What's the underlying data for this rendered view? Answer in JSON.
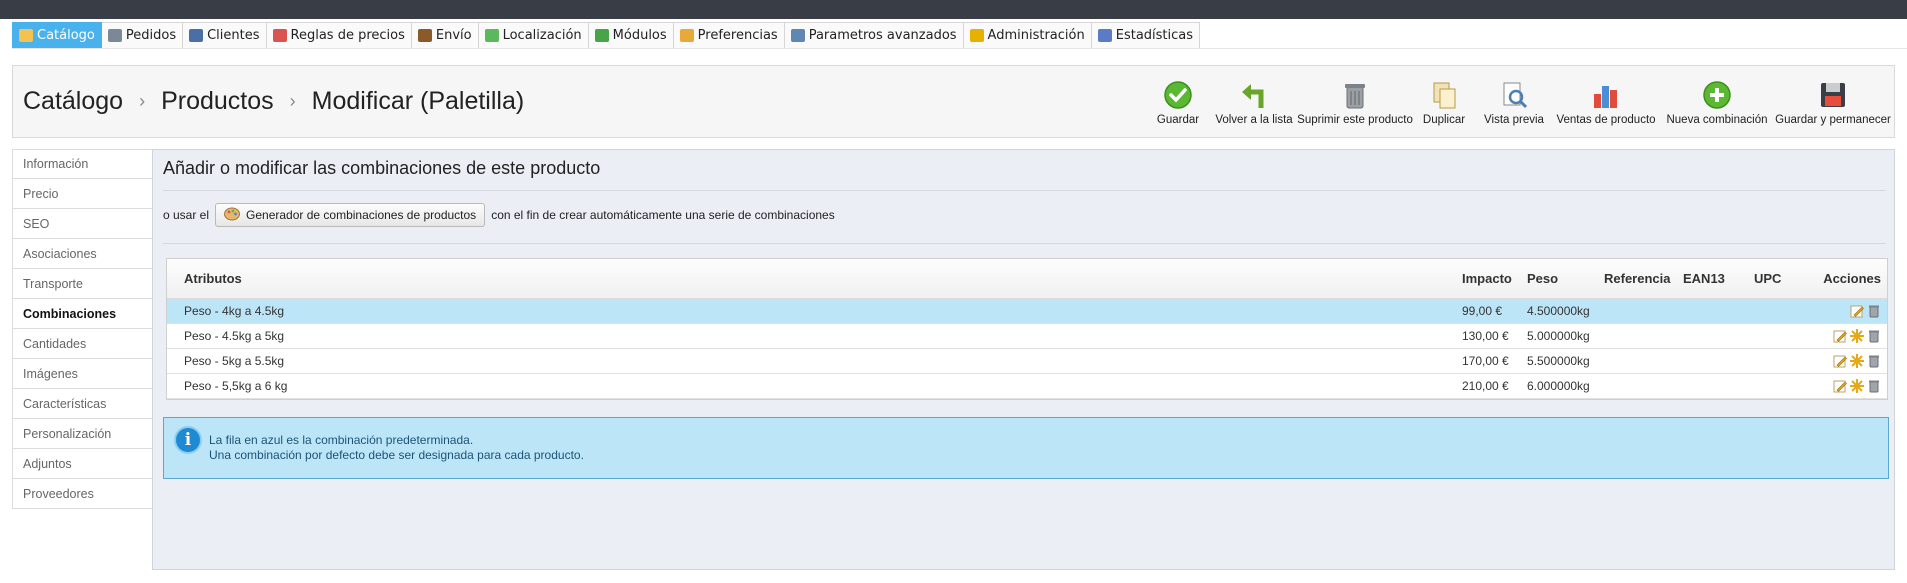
{
  "nav": {
    "items": [
      {
        "label": "Catálogo",
        "icon": "folder-icon",
        "color": "#f3c24f"
      },
      {
        "label": "Pedidos",
        "icon": "cart-icon",
        "color": "#7b8896"
      },
      {
        "label": "Clientes",
        "icon": "user-icon",
        "color": "#4a6fa5"
      },
      {
        "label": "Reglas de precios",
        "icon": "price-rules-icon",
        "color": "#d9534f"
      },
      {
        "label": "Envío",
        "icon": "truck-icon",
        "color": "#8a5a2b"
      },
      {
        "label": "Localización",
        "icon": "globe-icon",
        "color": "#5cb85c"
      },
      {
        "label": "Módulos",
        "icon": "puzzle-icon",
        "color": "#47a447"
      },
      {
        "label": "Preferencias",
        "icon": "preferences-icon",
        "color": "#e8a93a"
      },
      {
        "label": "Parametros avanzados",
        "icon": "wrench-icon",
        "color": "#5f87b3"
      },
      {
        "label": "Administración",
        "icon": "key-icon",
        "color": "#e6b100"
      },
      {
        "label": "Estadísticas",
        "icon": "stats-icon",
        "color": "#5b7bc7"
      }
    ],
    "active_index": 0,
    "active_color": "#49b2ec"
  },
  "breadcrumb": {
    "items": [
      "Catálogo",
      "Productos",
      "Modificar (Paletilla)"
    ]
  },
  "toolbar": {
    "items": [
      {
        "label": "Guardar",
        "icon": "save-check-icon"
      },
      {
        "label": "Volver a la lista",
        "icon": "back-arrow-icon"
      },
      {
        "label": "Suprimir este producto",
        "icon": "trash-icon"
      },
      {
        "label": "Duplicar",
        "icon": "duplicate-icon"
      },
      {
        "label": "Vista previa",
        "icon": "preview-icon"
      },
      {
        "label": "Ventas de producto",
        "icon": "sales-chart-icon"
      },
      {
        "label": "Nueva combinación",
        "icon": "add-icon"
      },
      {
        "label": "Guardar y permanecer",
        "icon": "floppy-icon"
      }
    ]
  },
  "sidebar": {
    "items": [
      "Información",
      "Precio",
      "SEO",
      "Asociaciones",
      "Transporte",
      "Combinaciones",
      "Cantidades",
      "Imágenes",
      "Características",
      "Personalización",
      "Adjuntos",
      "Proveedores"
    ],
    "active_index": 5
  },
  "content": {
    "title": "Añadir o modificar las combinaciones de este producto",
    "generator": {
      "prefix": "o usar el",
      "button_label": "Generador de combinaciones de productos",
      "suffix": "con el fin de crear automáticamente una serie de combinaciones"
    },
    "table": {
      "headers": {
        "atributos": "Atributos",
        "impacto": "Impacto",
        "peso": "Peso",
        "referencia": "Referencia",
        "ean13": "EAN13",
        "upc": "UPC",
        "acciones": "Acciones"
      },
      "rows": [
        {
          "attr": "Peso - 4kg a 4.5kg",
          "impacto": "99,00 €",
          "peso": "4.500000kg",
          "referencia": "",
          "ean13": "",
          "upc": "",
          "default": true
        },
        {
          "attr": "Peso - 4.5kg a 5kg",
          "impacto": "130,00 €",
          "peso": "5.000000kg",
          "referencia": "",
          "ean13": "",
          "upc": "",
          "default": false
        },
        {
          "attr": "Peso - 5kg a 5.5kg",
          "impacto": "170,00 €",
          "peso": "5.500000kg",
          "referencia": "",
          "ean13": "",
          "upc": "",
          "default": false
        },
        {
          "attr": "Peso - 5,5kg a 6 kg",
          "impacto": "210,00 €",
          "peso": "6.000000kg",
          "referencia": "",
          "ean13": "",
          "upc": "",
          "default": false
        }
      ],
      "default_row_color": "#bde5f8"
    },
    "info": {
      "line1": "La fila en azul es la combinación predeterminada.",
      "line2": "Una combinación por defecto debe ser designada para cada producto."
    }
  }
}
